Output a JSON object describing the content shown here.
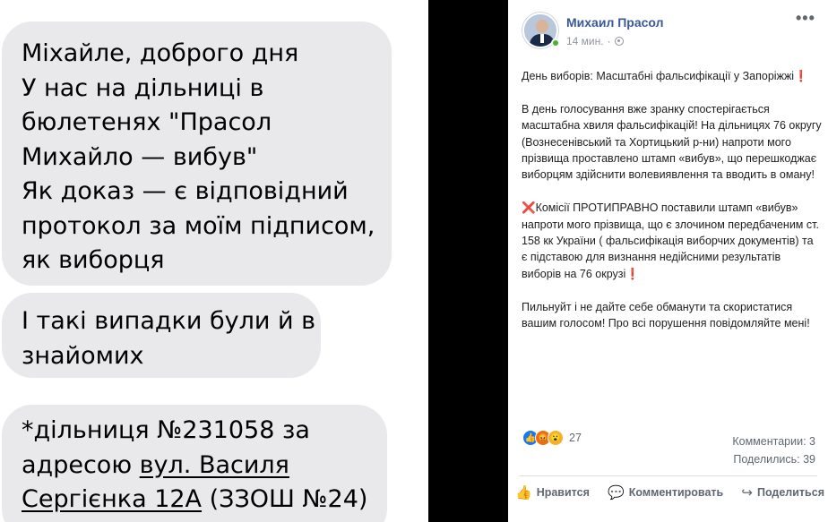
{
  "chat": {
    "bubble1": [
      "Міхайле, доброго дня",
      "У нас на дільниці в",
      "бюлетенях \"Прасол",
      "Михайло — вибув\"",
      "Як доказ — є відповідний",
      "протокол за моїм підписом,",
      "як виборця"
    ],
    "bubble2": [
      "І такі випадки були й в",
      "знайомих"
    ],
    "bubble3": {
      "line1": "*дільниця №231058 за",
      "line2_plain": "адресою ",
      "line2_link": "вул. Василя",
      "line3_link": "Сергієнка 12А",
      "line3_plain": " (ЗЗОШ №24)"
    }
  },
  "post": {
    "author": "Михаил Прасол",
    "time": "14 мин.",
    "dot": "·",
    "more": "•••",
    "para1_text": "День виборів: Масштабні фальсифікації у Запоріжжі",
    "para1_emoji": "❗",
    "para2": "В день голосування вже зранку спостерігається масштабна хвиля фальсифікацій! На дільницях 76 округу (Вознесенівський та Хортицький р-ни) напроти мого прізвища проставлено штамп «вибув», що перешкоджає виборцям здійснити волевиявлення та вводить в оману!",
    "para3_emoji": "❌",
    "para3_text": "Комісії ПРОТИПРАВНО поставили штамп «вибув» напроти мого прізвища, що є злочином передбаченим ст. 158 кк України ( фальсифікація виборчих документів) та є підставою для визнання недійсними результатів виборів на 76 окрузі",
    "para3_emoji_end": "❗",
    "para4": "Пильнуйт і не дайте себе обманути та скористатися вашим голосом! Про всі порушення повідомляйте мені!",
    "reactions_count": "27",
    "comments": "Комментарии: 3",
    "shares": "Поделились: 39",
    "actions": {
      "like": "Нравится",
      "comment": "Комментировать",
      "share": "Поделиться"
    },
    "icons": {
      "like_reaction": "👍",
      "angry_reaction": "😡",
      "wow_reaction": "😮",
      "like": "👍",
      "comment": "💬",
      "share": "↪"
    }
  }
}
